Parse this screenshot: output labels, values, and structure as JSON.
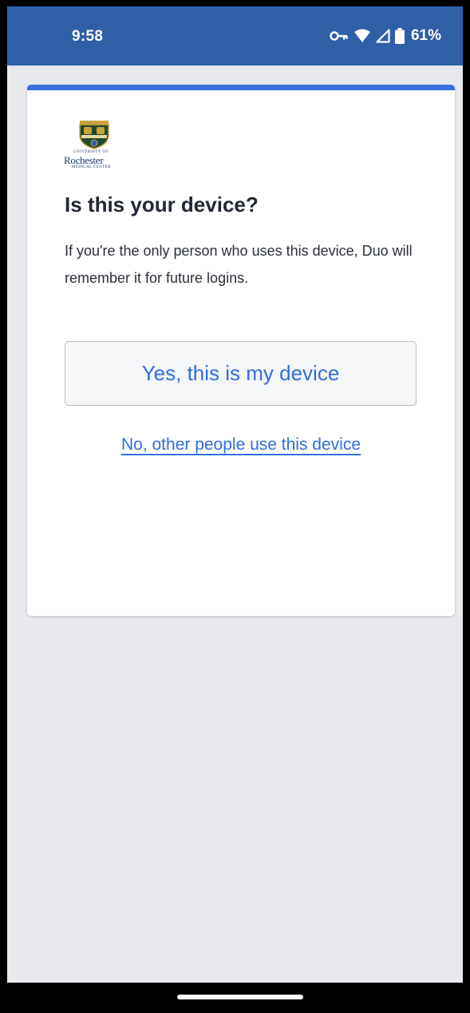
{
  "status_bar": {
    "time": "9:58",
    "battery_percent": "61%",
    "icons": [
      "vpn-key-icon",
      "wifi-icon",
      "cell-signal-icon",
      "battery-icon"
    ],
    "background_color": "#2f5fa7"
  },
  "logo": {
    "line1": "University of",
    "line2": "Rochester",
    "line3": "Medical Center"
  },
  "card": {
    "accent_color": "#3b6fe0",
    "title": "Is this your device?",
    "description": "If you're the only person who uses this device, Duo will remember it for future logins.",
    "primary_button_label": "Yes, this is my device",
    "secondary_link_label": "No, other people use this device"
  }
}
